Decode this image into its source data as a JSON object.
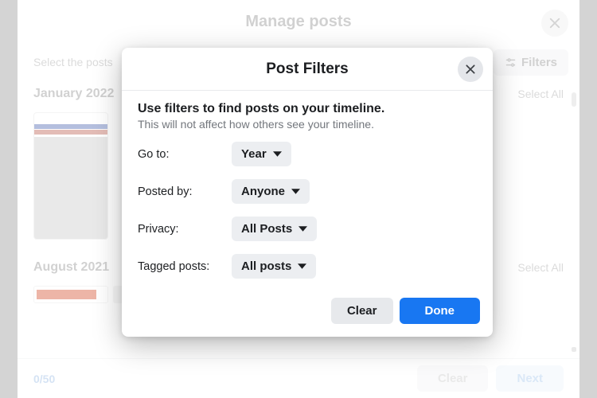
{
  "page": {
    "title": "Manage posts",
    "prompt": "Select the posts",
    "filters_button": "Filters",
    "counter": "0/50",
    "clear": "Clear",
    "next": "Next"
  },
  "sections": [
    {
      "title": "January 2022",
      "select_all": "Select All"
    },
    {
      "title": "August 2021",
      "select_all": "Select All"
    }
  ],
  "modal": {
    "title": "Post Filters",
    "lead": "Use filters to find posts on your timeline.",
    "sub": "This will not affect how others see your timeline.",
    "rows": {
      "go_to": {
        "label": "Go to:",
        "value": "Year"
      },
      "posted_by": {
        "label": "Posted by:",
        "value": "Anyone"
      },
      "privacy": {
        "label": "Privacy:",
        "value": "All Posts"
      },
      "tagged": {
        "label": "Tagged posts:",
        "value": "All posts"
      }
    },
    "clear": "Clear",
    "done": "Done"
  }
}
